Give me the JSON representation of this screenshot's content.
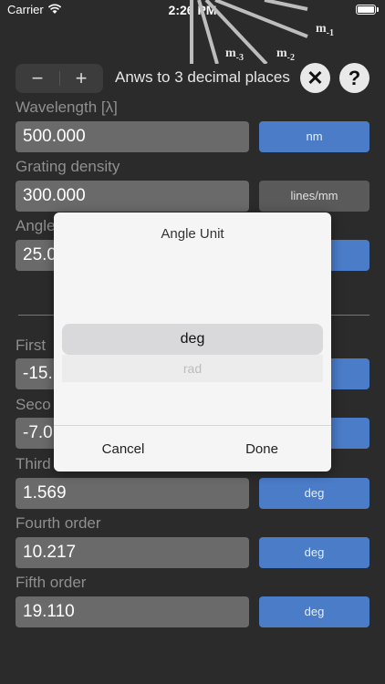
{
  "status_bar": {
    "carrier": "Carrier",
    "time": "2:26 PM"
  },
  "diagram": {
    "labels": [
      "m-1",
      "m-2",
      "m-3"
    ]
  },
  "toolbar": {
    "minus": "−",
    "plus": "+",
    "decimal_label": "Anws to 3 decimal places",
    "clear": "✕",
    "help": "?"
  },
  "inputs": {
    "wavelength": {
      "label": "Wavelength [λ]",
      "value": "500.000",
      "unit": "nm"
    },
    "grating": {
      "label": "Grating density",
      "value": "300.000",
      "unit": "lines/mm"
    },
    "angle": {
      "label": "Angle",
      "value": "25.0"
    }
  },
  "orders": [
    {
      "label": "First",
      "value": "-15."
    },
    {
      "label": "Seco",
      "value": "-7.0"
    },
    {
      "label": "Third",
      "value": "1.569",
      "unit": "deg"
    },
    {
      "label": "Fourth order",
      "value": "10.217",
      "unit": "deg"
    },
    {
      "label": "Fifth order",
      "value": "19.110",
      "unit": "deg"
    }
  ],
  "dialog": {
    "title": "Angle Unit",
    "options": [
      "deg",
      "rad"
    ],
    "cancel": "Cancel",
    "done": "Done"
  },
  "colors": {
    "background": "#2b2b2b",
    "accent": "#4a7cc8",
    "field": "#6a6a6a"
  }
}
